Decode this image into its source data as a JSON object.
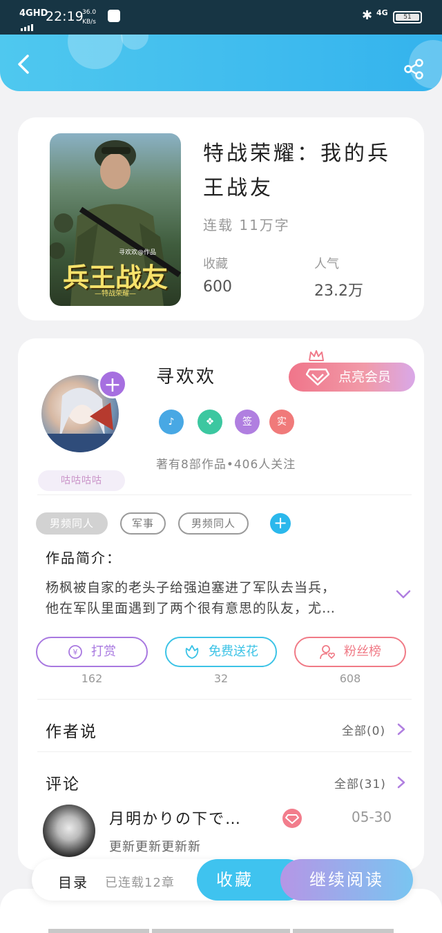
{
  "status_bar": {
    "network": "4GHD",
    "time": "22:19",
    "speed_value": "36.0",
    "speed_unit": "KB/s",
    "mobile_data": "4G",
    "battery": "51"
  },
  "book": {
    "cover_title": "兵王战友",
    "cover_author": "寻欢欢@作品",
    "cover_subtitle": "—特战荣耀—",
    "title": "特战荣耀：我的兵王战友",
    "status": "连载 11万字",
    "favorites_label": "收藏",
    "favorites_value": "600",
    "popularity_label": "人气",
    "popularity_value": "23.2万"
  },
  "author": {
    "name": "寻欢欢",
    "vip_button": "点亮会员",
    "avatar_tag": "咕咕咕咕",
    "badges": [
      "",
      "",
      "签",
      "实"
    ],
    "meta": "著有8部作品•406人关注"
  },
  "tags": [
    "男频同人",
    "军事",
    "男频同人"
  ],
  "intro": {
    "heading": "作品简介：",
    "text_line1": "杨枫被自家的老头子给强迫塞进了军队去当兵，",
    "text_line2": "他在军队里面遇到了两个很有意思的队友，尤…"
  },
  "actions": [
    {
      "label": "打赏",
      "count": "162",
      "color": "#a878e0"
    },
    {
      "label": "免费送花",
      "count": "32",
      "color": "#3cc3e6"
    },
    {
      "label": "粉丝榜",
      "count": "608",
      "color": "#f07a86"
    }
  ],
  "author_says": {
    "title": "作者说",
    "more": "全部(0)"
  },
  "comments": {
    "title": "评论",
    "more": "全部(31)",
    "first": {
      "name": "月明かりの下で…",
      "date": "05-30",
      "text": "更新更新更新新"
    }
  },
  "bottom_bar": {
    "toc": "目录",
    "chapters": "已连载12章",
    "favorite": "收藏",
    "read": "继续阅读"
  },
  "colors": {
    "header": "#3fbcee",
    "accent_purple": "#a66fe0",
    "accent_blue": "#2bb8ec",
    "accent_pink": "#f0758a"
  }
}
